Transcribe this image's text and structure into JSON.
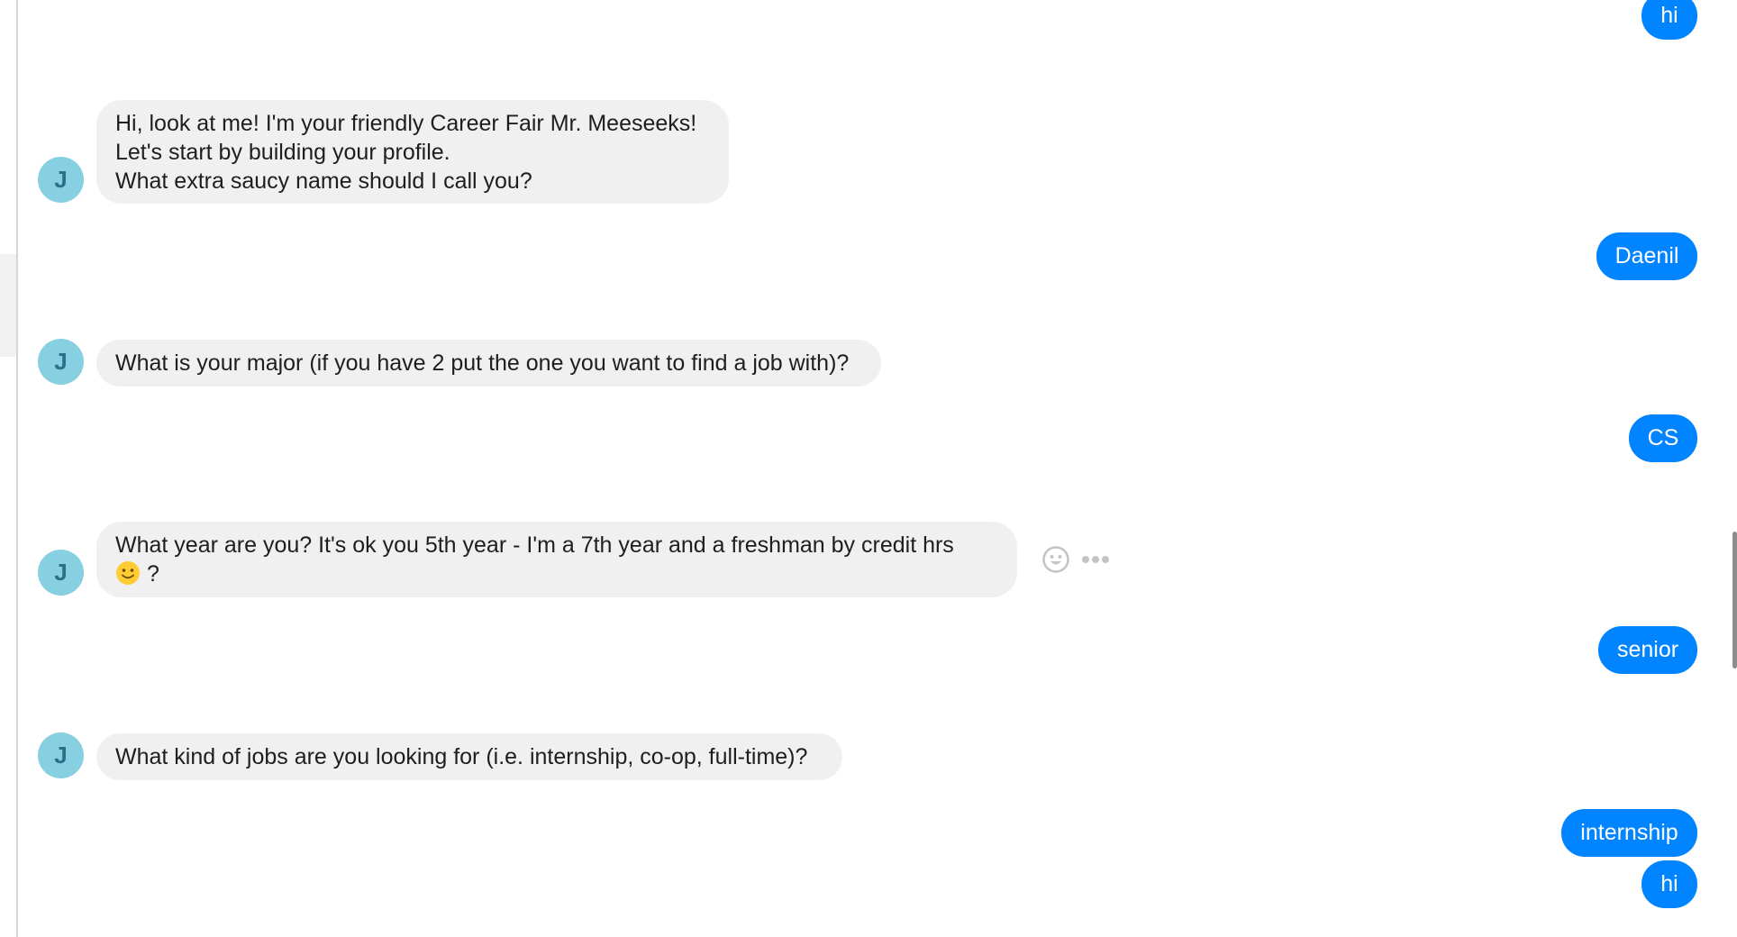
{
  "thread": {
    "messages": [
      {
        "from": "user",
        "text": "hi"
      },
      {
        "from": "bot",
        "avatar": "J",
        "lines": [
          "Hi, look at me! I'm your friendly Career Fair Mr. Meeseeks!",
          "Let's start by building your profile.",
          "What extra saucy name should I call you?"
        ]
      },
      {
        "from": "user",
        "text": "Daenil"
      },
      {
        "from": "bot",
        "avatar": "J",
        "lines": [
          "What is your major (if you have 2 put the one you want to find a job with)?"
        ]
      },
      {
        "from": "user",
        "text": "CS"
      },
      {
        "from": "bot",
        "avatar": "J",
        "lines": [
          "What year are you? It's ok you 5th year - I'm a 7th year and a freshman by credit hrs",
          "?"
        ],
        "emoji": "smiling-face-icon"
      },
      {
        "from": "user",
        "text": "senior"
      },
      {
        "from": "bot",
        "avatar": "J",
        "lines": [
          "What kind of jobs are you looking for (i.e. internship, co-op, full-time)?"
        ]
      },
      {
        "from": "user",
        "text": "internship"
      },
      {
        "from": "user",
        "text": "hi"
      }
    ]
  },
  "hover_actions": {
    "icons": [
      "react-smiley-icon",
      "more-options-icon"
    ]
  },
  "colors": {
    "user_bubble": "#0084ff",
    "bot_bubble": "#f1f0f0",
    "avatar_bg": "#86d0e1",
    "avatar_text": "#2c6f87"
  }
}
